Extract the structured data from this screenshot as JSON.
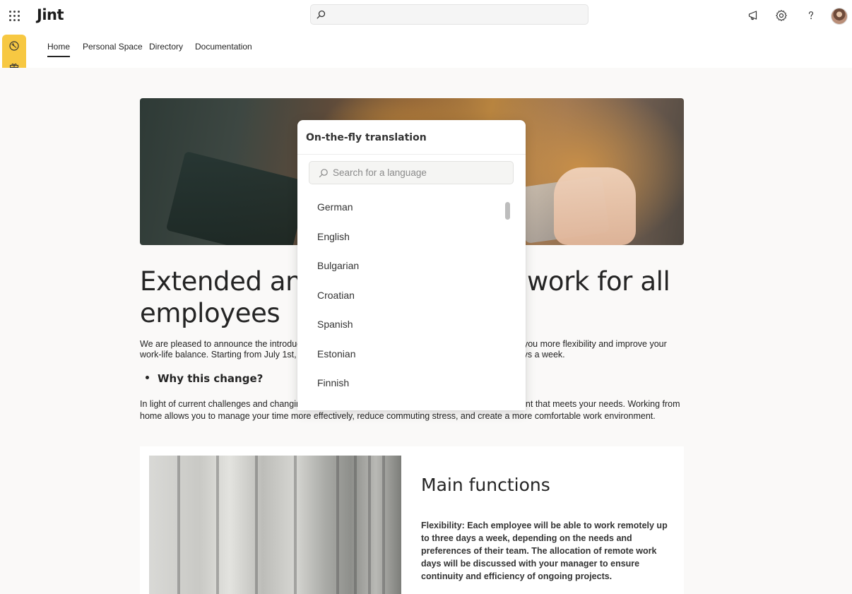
{
  "app": {
    "logo": "Jint"
  },
  "nav": {
    "tabs": [
      {
        "label": "Home"
      },
      {
        "label": "Personal Space"
      },
      {
        "label": "Directory"
      },
      {
        "label": "Documentation"
      }
    ]
  },
  "icons": {
    "apps": "waffle-icon",
    "search": "search-icon",
    "announce": "megaphone-icon",
    "settings": "gear-icon",
    "help": "help-icon",
    "rail": [
      "dashboard-icon",
      "gift-icon",
      "search-icon",
      "plus-icon"
    ]
  },
  "colors": {
    "accent": "#f7c842",
    "text": "#242424",
    "page_bg": "#faf9f8"
  },
  "article": {
    "headline_line1": "Extended and flexible remote work for all",
    "headline_line2": "employees",
    "intro": "We are pleased to announce the introduction of an extended remote work policy, designed to give you more flexibility and improve your work-life balance. Starting from July 1st, all employees will be able to work remotely up to three days a week.",
    "bullet": "Why this change?",
    "paragraph": "In light of current challenges and changing expectations, we want to offer you a working environment that meets your needs. Working from home allows you to manage your time more effectively, reduce commuting stress, and create a more comfortable work environment."
  },
  "card": {
    "title": "Main functions",
    "text": "Flexibility: Each employee will be able to work remotely up to three days a week, depending on the needs and preferences of their team. The allocation of remote work days will be discussed with your manager to ensure continuity and efficiency of ongoing projects."
  },
  "translation": {
    "title": "On-the-fly translation",
    "search_placeholder": "Search for a language",
    "languages": [
      "German",
      "English",
      "Bulgarian",
      "Croatian",
      "Spanish",
      "Estonian",
      "Finnish"
    ]
  }
}
